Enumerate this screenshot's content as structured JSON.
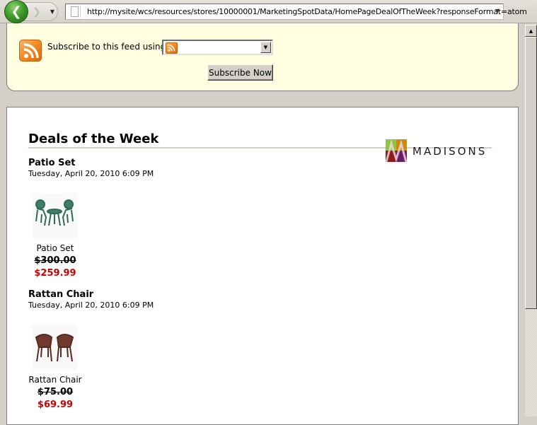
{
  "browser": {
    "url": "http://mysite/wcs/resources/stores/10000001/MarketingSpotData/HomePageDealOfTheWeek?responseFormat=atom",
    "icons": {
      "back": "back-arrow-icon",
      "forward": "forward-arrow-icon",
      "history": "chevron-down-icon",
      "page": "page-icon"
    },
    "back_glyph": "❮",
    "forward_glyph": "❯",
    "dropdown_glyph": "▼"
  },
  "feed_header": {
    "subscribe_label": "Subscribe to this feed using",
    "reader_select_value": "",
    "subscribe_button": "Subscribe Now",
    "icons": {
      "feed": "rss-feed-icon"
    }
  },
  "content": {
    "title": "Deals of the Week",
    "logo_text": "MADISONS",
    "logo_colors": [
      "#8dc63f",
      "#c98a1a",
      "#8b1a1a",
      "#6b1f6b"
    ],
    "deals": [
      {
        "title": "Patio Set",
        "date": "Tuesday, April 20, 2010 6:09 PM",
        "product_name": "Patio Set",
        "list_price": "$300.00",
        "offer_price": "$259.99",
        "image": "patio-set-image"
      },
      {
        "title": "Rattan Chair",
        "date": "Tuesday, April 20, 2010 6:09 PM",
        "product_name": "Rattan Chair",
        "list_price": "$75.00",
        "offer_price": "$69.99",
        "image": "rattan-chair-image"
      }
    ]
  },
  "colors": {
    "offer_price": "#cc0000",
    "feed_background": "#ffffe1",
    "chrome": "#d4d0c8"
  },
  "scrollbar": {
    "up_glyph": "▲",
    "position_fraction": 0
  }
}
